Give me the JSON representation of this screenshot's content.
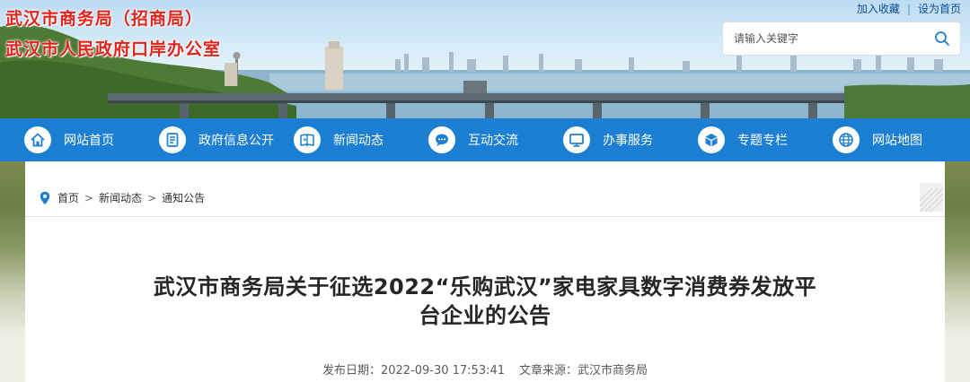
{
  "header": {
    "title_line1": "武汉市商务局（招商局）",
    "title_line2": "武汉市人民政府口岸办公室",
    "links": {
      "favorite": "加入收藏",
      "separator": "|",
      "homepage": "设为首页"
    },
    "search": {
      "placeholder": "请输入关键字",
      "icon": "search-icon"
    }
  },
  "nav": {
    "items": [
      {
        "label": "网站首页",
        "icon": "home-icon"
      },
      {
        "label": "政府信息公开",
        "icon": "document-icon"
      },
      {
        "label": "新闻动态",
        "icon": "news-book-icon"
      },
      {
        "label": "互动交流",
        "icon": "chat-icon"
      },
      {
        "label": "办事服务",
        "icon": "monitor-icon"
      },
      {
        "label": "专题专栏",
        "icon": "cube-icon"
      },
      {
        "label": "网站地图",
        "icon": "globe-icon"
      }
    ],
    "active_index": 0
  },
  "breadcrumb": {
    "items": [
      "首页",
      "新闻动态",
      "通知公告"
    ],
    "separator": ">",
    "icon": "location-pin-icon"
  },
  "article": {
    "title_line1": "武汉市商务局关于征选2022“乐购武汉”家电家具数字消费券发放平",
    "title_line2": "台企业的公告",
    "publish_label": "发布日期：",
    "publish_date": "2022-09-30 17:53:41",
    "source_label": "文章来源：",
    "source": "武汉市商务局"
  },
  "colors": {
    "nav_bg": "#1c7fd4",
    "title_red": "#e3241b",
    "link_blue": "#0c4e96"
  }
}
